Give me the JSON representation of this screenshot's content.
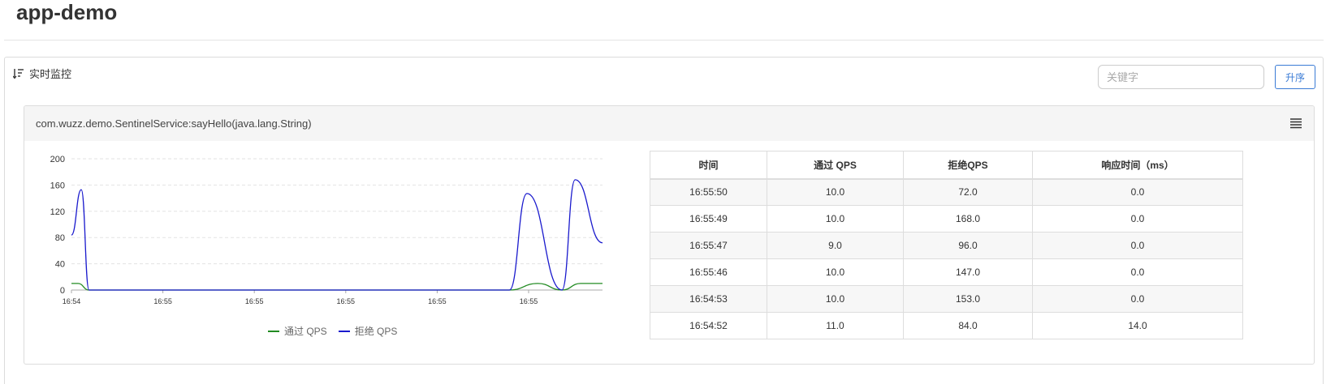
{
  "app": {
    "title": "app-demo"
  },
  "panel": {
    "title": "实时监控",
    "search_placeholder": "关键字",
    "sort_label": "升序"
  },
  "resource": {
    "name": "com.wuzz.demo.SentinelService:sayHello(java.lang.String)"
  },
  "chart_data": {
    "type": "line",
    "x": [
      "16:54",
      "16:55",
      "16:55",
      "16:55",
      "16:55",
      "16:55"
    ],
    "ylim": [
      0,
      200
    ],
    "yticks": [
      0,
      40,
      80,
      120,
      160,
      200
    ],
    "grid": true,
    "legend_position": "bottom-center",
    "series": [
      {
        "name": "通过 QPS",
        "color": "#228b22",
        "points": [
          [
            0,
            10
          ],
          [
            0.6,
            10
          ],
          [
            1.6,
            0
          ],
          [
            40,
            0
          ],
          [
            42.6,
            10
          ],
          [
            44.8,
            0
          ],
          [
            46.5,
            10
          ],
          [
            48.5,
            10
          ]
        ]
      },
      {
        "name": "拒绝 QPS",
        "color": "#1a1acd",
        "points": [
          [
            0,
            84
          ],
          [
            0.9,
            153
          ],
          [
            1.6,
            0
          ],
          [
            40,
            0
          ],
          [
            41.6,
            147
          ],
          [
            44.8,
            0
          ],
          [
            46.0,
            168
          ],
          [
            48.5,
            72
          ]
        ]
      }
    ],
    "x_span": 48.5
  },
  "legend": [
    "通过 QPS",
    "拒绝 QPS"
  ],
  "table": {
    "headers": [
      "时间",
      "通过 QPS",
      "拒绝QPS",
      "响应时间（ms）"
    ],
    "rows": [
      [
        "16:55:50",
        "10.0",
        "72.0",
        "0.0"
      ],
      [
        "16:55:49",
        "10.0",
        "168.0",
        "0.0"
      ],
      [
        "16:55:47",
        "9.0",
        "96.0",
        "0.0"
      ],
      [
        "16:55:46",
        "10.0",
        "147.0",
        "0.0"
      ],
      [
        "16:54:53",
        "10.0",
        "153.0",
        "0.0"
      ],
      [
        "16:54:52",
        "11.0",
        "84.0",
        "14.0"
      ]
    ]
  }
}
